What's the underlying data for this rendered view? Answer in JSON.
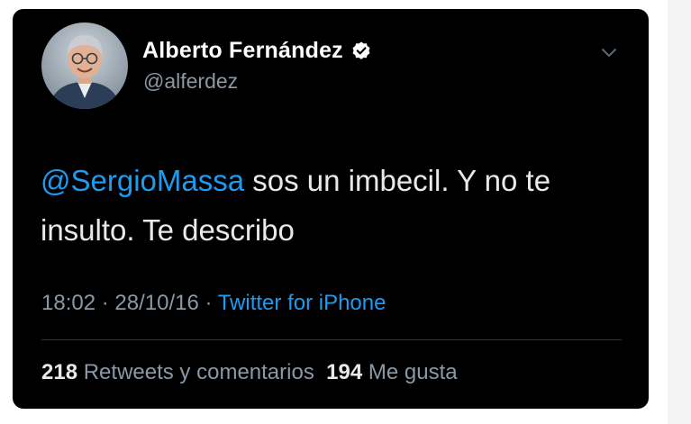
{
  "tweet": {
    "author_name": "Alberto Fernández",
    "handle": "@alferdez",
    "mention": "@SergioMassa",
    "text_after_mention": " sos un imbecil. Y no te insulto. Te describo",
    "time": "18:02",
    "separator": " · ",
    "date": "28/10/16",
    "source": "Twitter for iPhone",
    "stats": {
      "retweets_count": "218",
      "retweets_label": "Retweets y comentarios",
      "likes_count": "194",
      "likes_label": "Me gusta"
    }
  },
  "icons": {
    "verified": "verified-badge-icon",
    "more": "chevron-down-icon"
  },
  "colors": {
    "background": "#000000",
    "accent": "#1d9bf0",
    "secondary_text": "#8b98a5",
    "primary_text": "#e7e9ea"
  }
}
